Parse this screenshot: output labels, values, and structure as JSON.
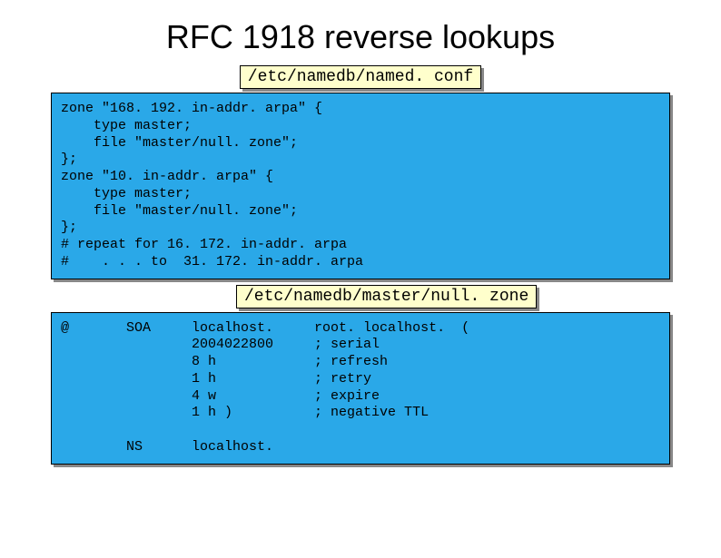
{
  "title": "RFC 1918 reverse lookups",
  "label1": "/etc/namedb/named. conf",
  "code1": "zone \"168. 192. in-addr. arpa\" {\n    type master;\n    file \"master/null. zone\";\n};\nzone \"10. in-addr. arpa\" {\n    type master;\n    file \"master/null. zone\";\n};\n# repeat for 16. 172. in-addr. arpa\n#    . . . to  31. 172. in-addr. arpa",
  "label2": "/etc/namedb/master/null. zone",
  "code2": "@       SOA     localhost.     root. localhost.  (\n                2004022800     ; serial\n                8 h            ; refresh\n                1 h            ; retry\n                4 w            ; expire\n                1 h )          ; negative TTL\n\n        NS      localhost."
}
